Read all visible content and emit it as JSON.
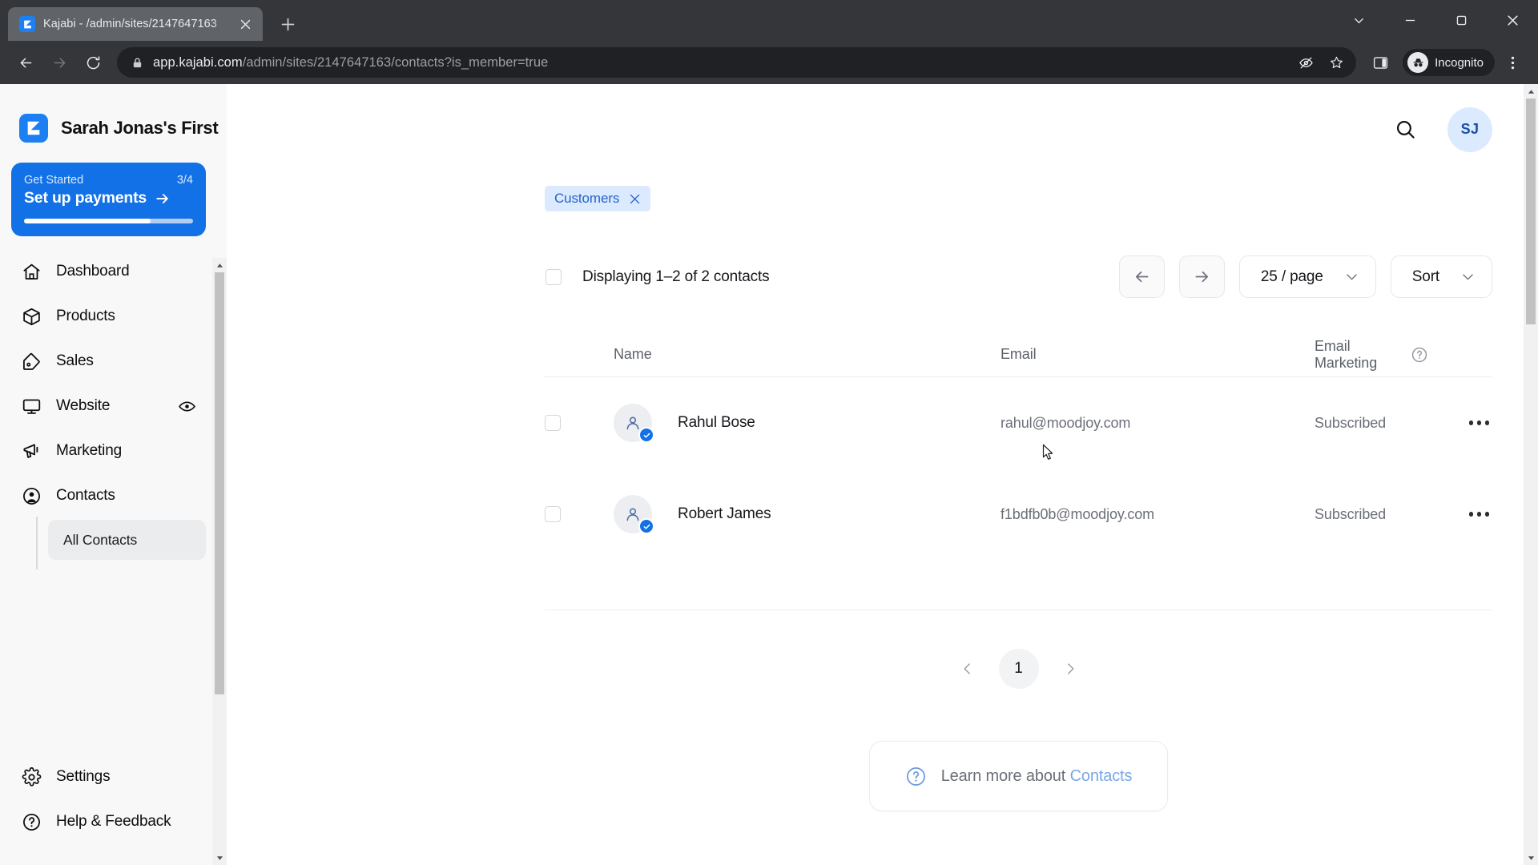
{
  "browser": {
    "tab": {
      "title": "Kajabi - /admin/sites/2147647163",
      "favicon": "kajabi-logo-icon"
    },
    "newtab_tooltip": "New Tab",
    "url_host": "app.kajabi.com",
    "url_path": "/admin/sites/2147647163/contacts?is_member=true",
    "profile_label": "Incognito"
  },
  "sidebar": {
    "brand": "Sarah Jonas's First",
    "get_started": {
      "label": "Get Started",
      "count": "3/4",
      "title": "Set up payments",
      "progress_percent": 75
    },
    "items": [
      {
        "label": "Dashboard",
        "icon": "home-icon"
      },
      {
        "label": "Products",
        "icon": "box-icon"
      },
      {
        "label": "Sales",
        "icon": "tag-icon"
      },
      {
        "label": "Website",
        "icon": "monitor-icon",
        "trailing_icon": "eye-icon"
      },
      {
        "label": "Marketing",
        "icon": "megaphone-icon"
      },
      {
        "label": "Contacts",
        "icon": "user-circle-icon"
      }
    ],
    "subnav": [
      {
        "label": "All Contacts",
        "active": true
      }
    ],
    "bottom_items": [
      {
        "label": "Settings",
        "icon": "gear-icon"
      },
      {
        "label": "Help & Feedback",
        "icon": "question-circle-icon"
      }
    ]
  },
  "topbar": {
    "search_icon": "search-icon",
    "avatar_initials": "SJ"
  },
  "filters": {
    "chips": [
      {
        "label": "Customers",
        "removable": true
      }
    ]
  },
  "list_header": {
    "displaying": "Displaying 1–2 of 2 contacts",
    "prev_label": "Previous page",
    "next_label": "Next page",
    "per_page": "25 / page",
    "sort": "Sort"
  },
  "table": {
    "columns": [
      "Name",
      "Email",
      "Email Marketing"
    ],
    "email_marketing_help": "?",
    "rows": [
      {
        "name": "Rahul Bose",
        "email": "rahul@moodjoy.com",
        "email_marketing": "Subscribed",
        "verified": true
      },
      {
        "name": "Robert James",
        "email": "f1bdfb0b@moodjoy.com",
        "email_marketing": "Subscribed",
        "verified": true
      }
    ]
  },
  "pagination": {
    "current_page": "1"
  },
  "footer": {
    "learn_prefix": "Learn more about ",
    "learn_link": "Contacts"
  },
  "colors": {
    "accent": "#1271e6",
    "chip_bg": "#dbeafe",
    "chip_text": "#2563c9",
    "link": "#7aa7e8"
  }
}
